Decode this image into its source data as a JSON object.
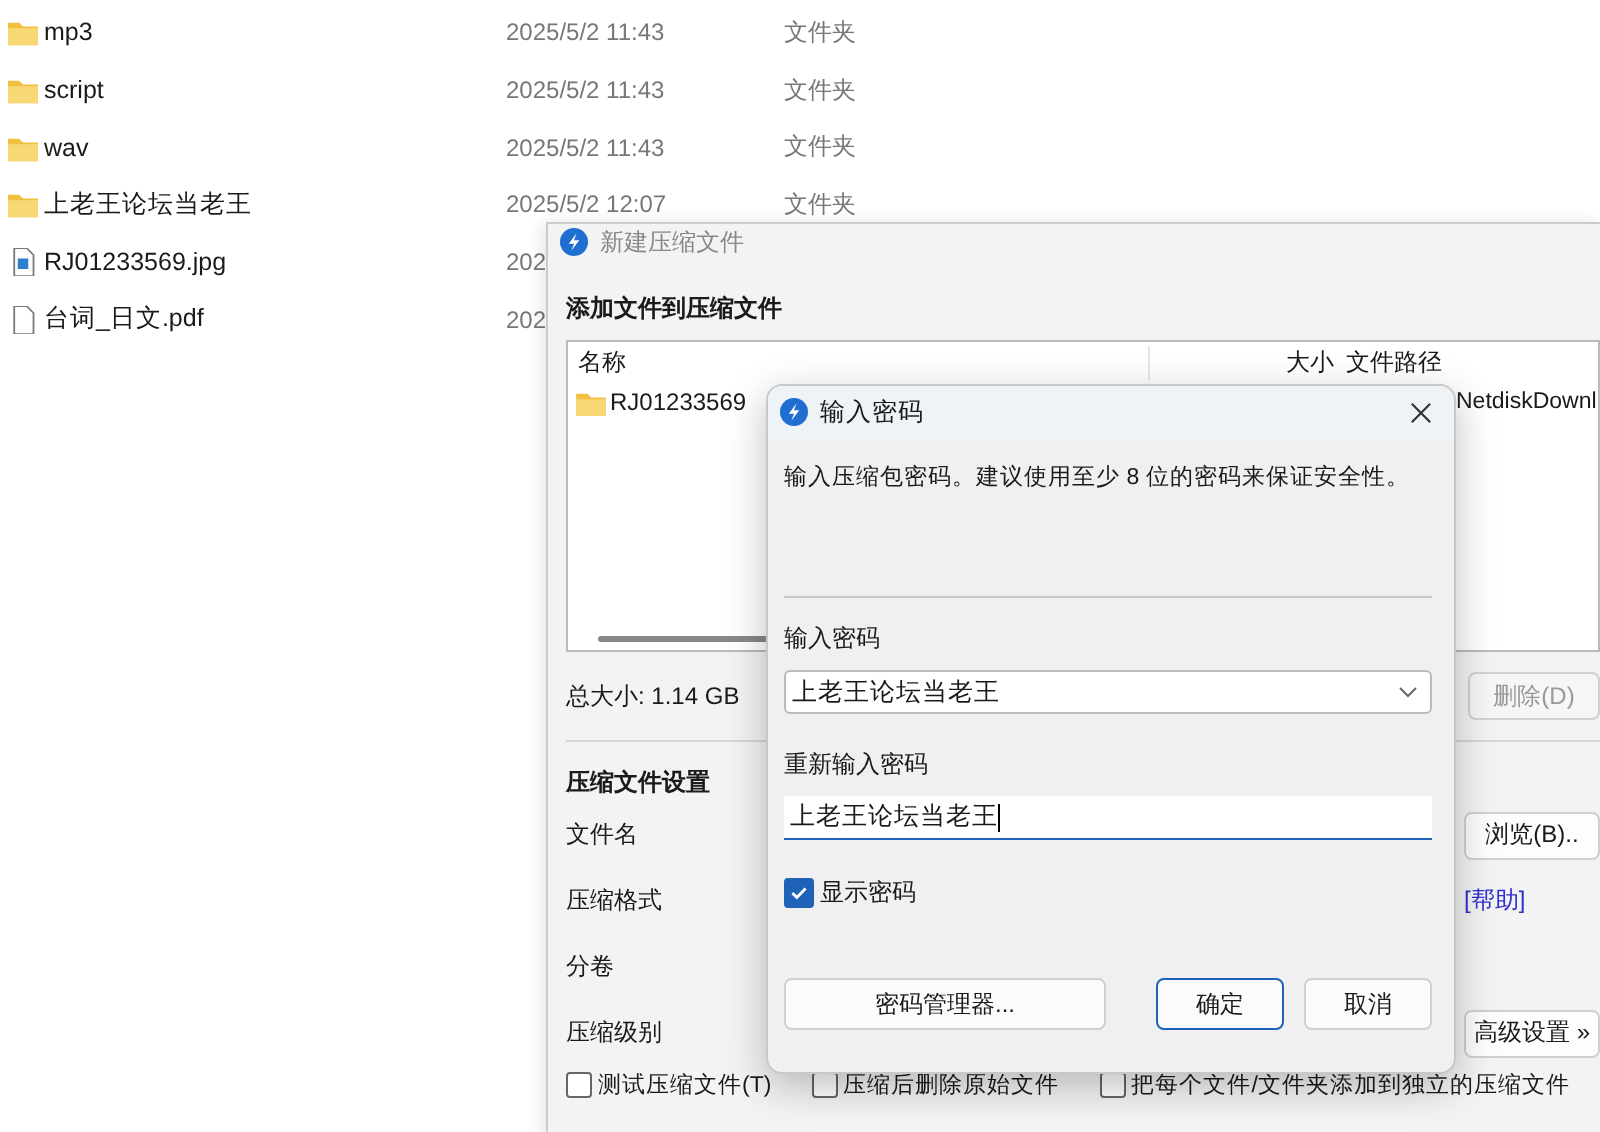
{
  "explorer": {
    "rows": [
      {
        "kind": "folder",
        "name": "mp3",
        "modified": "2025/5/2 11:43",
        "type": "文件夹"
      },
      {
        "kind": "folder",
        "name": "script",
        "modified": "2025/5/2 11:43",
        "type": "文件夹"
      },
      {
        "kind": "folder",
        "name": "wav",
        "modified": "2025/5/2 11:43",
        "type": "文件夹"
      },
      {
        "kind": "folder",
        "name": "上老王论坛当老王",
        "modified": "2025/5/2 12:07",
        "type": "文件夹"
      },
      {
        "kind": "image",
        "name": "RJ01233569.jpg",
        "modified": "202"
      },
      {
        "kind": "document",
        "name": "台词_日文.pdf",
        "modified": "202"
      }
    ]
  },
  "archive_window": {
    "title": "新建压缩文件",
    "heading": "添加文件到压缩文件",
    "file_list": {
      "columns": [
        "名称",
        "大小",
        "文件路径"
      ],
      "rows": [
        {
          "name": "RJ01233569",
          "path": "NetdiskDownl"
        }
      ]
    },
    "total_size": "总大小: 1.14 GB",
    "delete_button": {
      "label": "删除(D)",
      "disabled": true
    },
    "settings_heading": "压缩文件设置",
    "settings": [
      {
        "label": "文件名",
        "kind": "button",
        "control": "浏览(B).."
      },
      {
        "label": "压缩格式",
        "kind": "link",
        "control": "[帮助]"
      },
      {
        "label": "分卷"
      },
      {
        "label": "压缩级别",
        "kind": "button",
        "control": "高级设置 »"
      }
    ],
    "options": [
      {
        "label": "测试压缩文件(T)",
        "checked": false
      },
      {
        "label": "压缩后删除原始文件",
        "checked": false
      },
      {
        "label": "把每个文件/文件夹添加到独立的压缩文件",
        "checked": false
      }
    ]
  },
  "password_dialog": {
    "title": "输入密码",
    "description": "输入压缩包密码。建议使用至少 8 位的密码来保证安全性。",
    "password_label": "输入密码",
    "password_value": "上老王论坛当老王",
    "confirm_label": "重新输入密码",
    "confirm_value": "上老王论坛当老王",
    "show_password": {
      "label": "显示密码",
      "checked": true
    },
    "buttons": [
      {
        "label": "密码管理器...",
        "default": false
      },
      {
        "label": "确定",
        "default": true
      },
      {
        "label": "取消",
        "default": false
      }
    ]
  }
}
